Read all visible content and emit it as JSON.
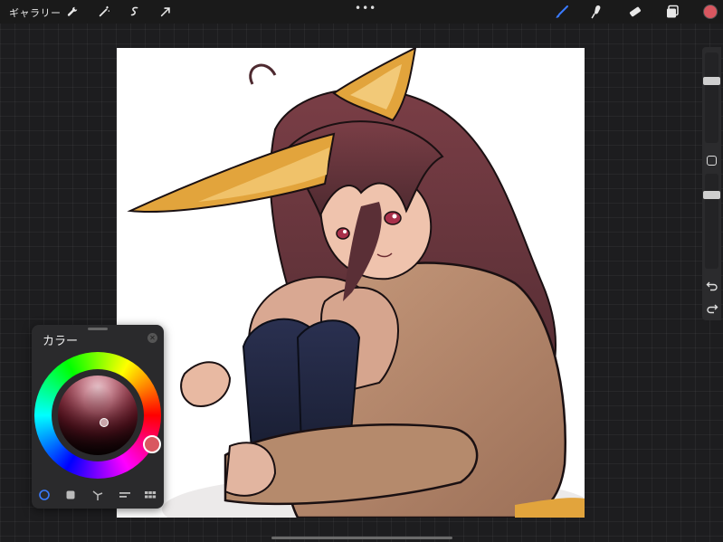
{
  "toolbar": {
    "gallery_label": "ギャラリー",
    "left_tools": [
      {
        "name": "wrench-icon"
      },
      {
        "name": "magic-wand-icon"
      },
      {
        "name": "selection-icon"
      },
      {
        "name": "transform-arrow-icon"
      }
    ],
    "more_label": "•••",
    "right_tools": [
      {
        "name": "brush-icon",
        "active": true
      },
      {
        "name": "smudge-icon"
      },
      {
        "name": "eraser-icon"
      },
      {
        "name": "layers-icon"
      }
    ],
    "current_color": "#d95760"
  },
  "colors": {
    "accent": "#3a7bff",
    "panel_bg": "#2a2a2c",
    "canvas_bg": "#ffffff",
    "hair": "#5a3238",
    "ears": "#e2a43c",
    "sweater": "#b98c70",
    "socks": "#1c2238"
  },
  "color_panel": {
    "title": "カラー",
    "selected_hue_color": "#d95760",
    "modes": [
      {
        "name": "disc-mode-icon",
        "active": true
      },
      {
        "name": "classic-mode-icon",
        "active": false
      },
      {
        "name": "harmony-mode-icon",
        "active": false
      },
      {
        "name": "value-mode-icon",
        "active": false
      },
      {
        "name": "palettes-mode-icon",
        "active": false
      }
    ]
  },
  "sidebar": {
    "brush_size_level": 0.3,
    "opacity_level": 0.2
  }
}
